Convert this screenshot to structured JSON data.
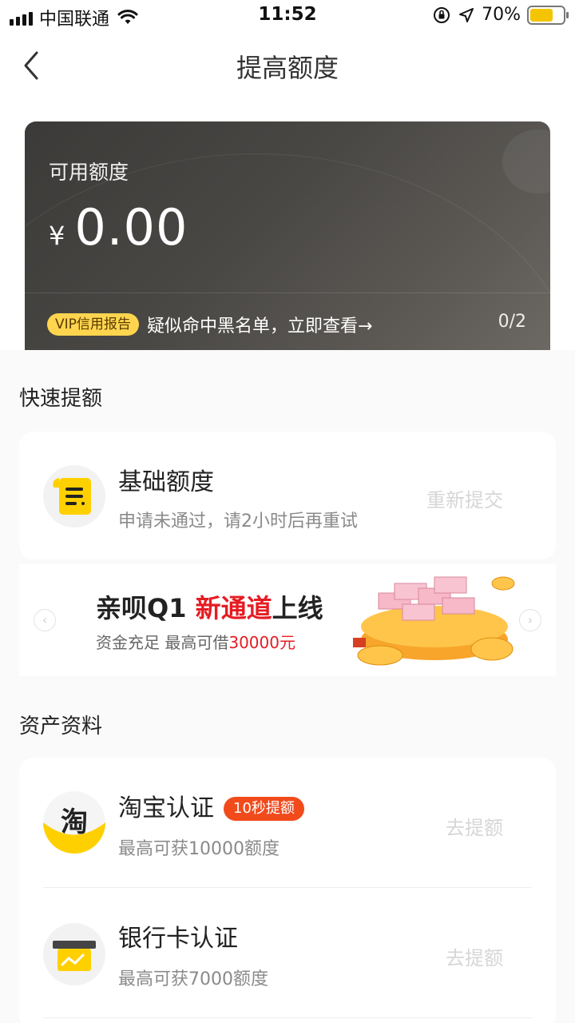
{
  "status_bar": {
    "carrier": "中国联通",
    "time": "11:52",
    "battery_pct": "70%",
    "battery_level": 0.7,
    "icons": [
      "signal-icon",
      "wifi-icon",
      "orientation-lock-icon",
      "location-icon",
      "battery-icon"
    ]
  },
  "nav": {
    "title": "提高额度",
    "back_icon": "chevron-left-icon"
  },
  "credit_card": {
    "label": "可用额度",
    "currency": "¥",
    "amount": "0.00",
    "vip_badge": "VIP信用报告",
    "notice": "疑似命中黑名单，立即查看→",
    "counter": "0/2"
  },
  "quick": {
    "section_title": "快速提额",
    "items": [
      {
        "icon": "document-icon",
        "title": "基础额度",
        "subtitle": "申请未通过，请2小时后再重试",
        "action": "重新提交"
      }
    ]
  },
  "banner": {
    "title_part1": "亲呗Q1 ",
    "title_highlight": "新通道",
    "title_part2": "上线",
    "subtitle_part1": "资金充足 最高可借",
    "subtitle_highlight": "30000元",
    "prev_icon": "chevron-left-circle-icon",
    "next_icon": "chevron-right-circle-icon",
    "colors": {
      "highlight": "#e51c23"
    }
  },
  "assets": {
    "section_title": "资产资料",
    "items": [
      {
        "icon": "taobao-icon",
        "icon_text": "淘",
        "title": "淘宝认证",
        "tag": "10秒提额",
        "subtitle": "最高可获10000额度",
        "action": "去提额"
      },
      {
        "icon": "bank-card-icon",
        "title": "银行卡认证",
        "subtitle": "最高可获7000额度",
        "action": "去提额"
      }
    ]
  },
  "colors": {
    "accent_yellow": "#f5c400",
    "tag_red": "#f14b1c",
    "card_dark": "#45433f"
  }
}
